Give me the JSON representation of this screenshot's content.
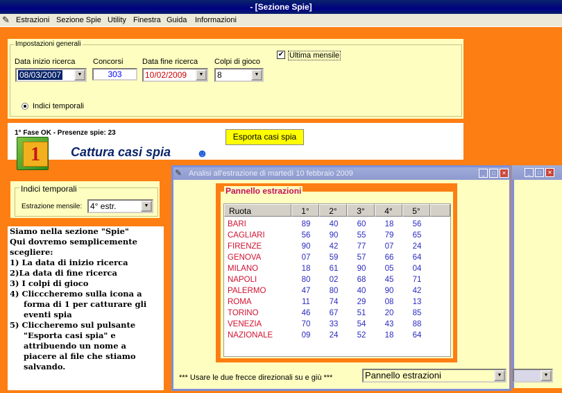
{
  "titlebar": {
    "title": "- [Sezione Spie]"
  },
  "menu": [
    "Estrazioni",
    "Sezione Spie",
    "Utility",
    "Finestra",
    "Guida",
    "Informazioni"
  ],
  "general": {
    "legend": "Impostazioni generali",
    "data_inizio_label": "Data inizio ricerca",
    "data_inizio_value": "08/03/2007",
    "concorsi_label": "Concorsi",
    "concorsi_value": "303",
    "data_fine_label": "Data fine ricerca",
    "data_fine_value": "10/02/2009",
    "colpi_label": "Colpi di gioco",
    "colpi_value": "8",
    "ultima_mensile_label": "Ultima mensile",
    "ultima_mensile_checked": true,
    "radio_label": "Indici temporali"
  },
  "fase": {
    "status": "1° Fase OK - Presenze spie: 23",
    "export_button": "Esporta casi spia",
    "capture_label": "Cattura casi spia",
    "capture_icon_digit": "1"
  },
  "indici": {
    "legend": "Indici temporali",
    "estrazione_label": "Estrazione mensile:",
    "estrazione_value": "4° estr."
  },
  "info": [
    "Siamo nella sezione \"Spie\"",
    "Qui dovremo semplicemente",
    "scegliere:",
    "1) La data di inizio ricerca",
    "2)La data di fine ricerca",
    "3) I colpi di gioco",
    "4) Clicccheremo sulla icona a",
    "forma di 1 per catturare gli",
    "eventi spia",
    "5) Cliccheremo sul pulsante",
    "\"Esporta casi spia\" e",
    "attribuendo un nome a",
    "piacere al file che stiamo",
    "salvando."
  ],
  "analysis": {
    "title": "Analisi all'estrazione di martedì 10 febbraio 2009",
    "panel_legend": "Pannello estrazioni",
    "columns": [
      "Ruota",
      "1°",
      "2°",
      "3°",
      "4°",
      "5°"
    ],
    "rows": [
      {
        "ruota": "BARI",
        "n": [
          "89",
          "40",
          "60",
          "18",
          "56"
        ]
      },
      {
        "ruota": "CAGLIARI",
        "n": [
          "56",
          "90",
          "55",
          "79",
          "65"
        ]
      },
      {
        "ruota": "FIRENZE",
        "n": [
          "90",
          "42",
          "77",
          "07",
          "24"
        ]
      },
      {
        "ruota": "GENOVA",
        "n": [
          "07",
          "59",
          "57",
          "66",
          "64"
        ]
      },
      {
        "ruota": "MILANO",
        "n": [
          "18",
          "61",
          "90",
          "05",
          "04"
        ]
      },
      {
        "ruota": "NAPOLI",
        "n": [
          "80",
          "02",
          "68",
          "45",
          "71"
        ]
      },
      {
        "ruota": "PALERMO",
        "n": [
          "47",
          "80",
          "40",
          "90",
          "42"
        ]
      },
      {
        "ruota": "ROMA",
        "n": [
          "11",
          "74",
          "29",
          "08",
          "13"
        ]
      },
      {
        "ruota": "TORINO",
        "n": [
          "46",
          "67",
          "51",
          "20",
          "85"
        ]
      },
      {
        "ruota": "VENEZIA",
        "n": [
          "70",
          "33",
          "54",
          "43",
          "88"
        ]
      },
      {
        "ruota": "NAZIONALE",
        "n": [
          "09",
          "24",
          "52",
          "18",
          "64"
        ]
      }
    ],
    "footer_hint": "*** Usare le due frecce direzionali su e giù ***",
    "footer_select": "Pannello estrazioni"
  },
  "colors": {
    "accent": "#fd7e12",
    "panel": "#fefec0",
    "ruota_text": "#d01030",
    "number_text": "#2a2ac0"
  },
  "icons": [
    "app-icon",
    "capture-one-icon",
    "figure-icon",
    "close-icon",
    "minimize-icon",
    "maximize-icon",
    "chevron-down-icon"
  ]
}
